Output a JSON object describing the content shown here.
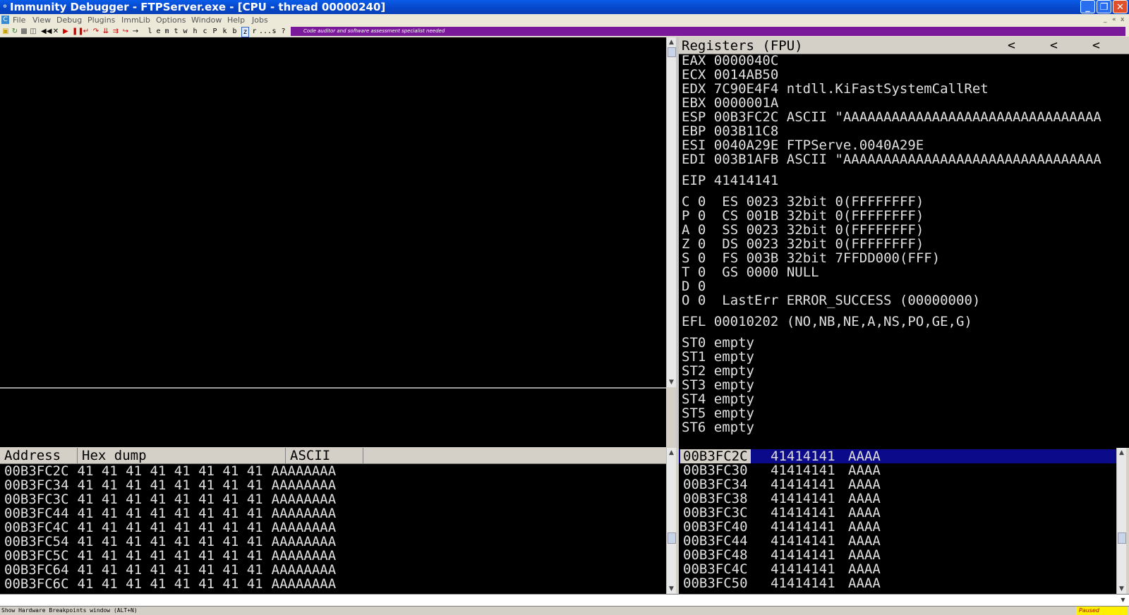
{
  "window": {
    "title": "Immunity Debugger - FTPServer.exe - [CPU - thread 00000240]",
    "min_icon": "minimize-icon",
    "max_icon": "restore-icon",
    "close_icon": "close-icon"
  },
  "menu": {
    "items": [
      "File",
      "View",
      "Debug",
      "Plugins",
      "ImmLib",
      "Options",
      "Window",
      "Help",
      "Jobs"
    ],
    "mdi_controls": [
      "_",
      "«",
      "x"
    ]
  },
  "toolbar": {
    "letters": [
      "l",
      "e",
      "m",
      "t",
      "w",
      "h",
      "c",
      "P",
      "k",
      "b",
      "z",
      "r",
      "...",
      "s",
      "?"
    ],
    "promo": "Code auditor and software assessment specialist needed"
  },
  "registers": {
    "header": "Registers (FPU)",
    "nav": [
      "<",
      "<",
      "<"
    ],
    "gp": [
      {
        "name": "EAX",
        "value": "0000040C",
        "comment": ""
      },
      {
        "name": "ECX",
        "value": "0014AB50",
        "comment": ""
      },
      {
        "name": "EDX",
        "value": "7C90E4F4",
        "comment": "ntdll.KiFastSystemCallRet"
      },
      {
        "name": "EBX",
        "value": "0000001A",
        "comment": ""
      },
      {
        "name": "ESP",
        "value": "00B3FC2C",
        "comment": "ASCII \"AAAAAAAAAAAAAAAAAAAAAAAAAAAAAAAA"
      },
      {
        "name": "EBP",
        "value": "003B11C8",
        "comment": ""
      },
      {
        "name": "ESI",
        "value": "0040A29E",
        "comment": "FTPServe.0040A29E"
      },
      {
        "name": "EDI",
        "value": "003B1AFB",
        "comment": "ASCII \"AAAAAAAAAAAAAAAAAAAAAAAAAAAAAAAA"
      }
    ],
    "eip": {
      "name": "EIP",
      "value": "41414141"
    },
    "flags": [
      {
        "flag": "C",
        "val": "0",
        "seg": "ES",
        "sel": "0023",
        "desc": "32bit 0(FFFFFFFF)"
      },
      {
        "flag": "P",
        "val": "0",
        "seg": "CS",
        "sel": "001B",
        "desc": "32bit 0(FFFFFFFF)"
      },
      {
        "flag": "A",
        "val": "0",
        "seg": "SS",
        "sel": "0023",
        "desc": "32bit 0(FFFFFFFF)"
      },
      {
        "flag": "Z",
        "val": "0",
        "seg": "DS",
        "sel": "0023",
        "desc": "32bit 0(FFFFFFFF)"
      },
      {
        "flag": "S",
        "val": "0",
        "seg": "FS",
        "sel": "003B",
        "desc": "32bit 7FFDD000(FFF)"
      },
      {
        "flag": "T",
        "val": "0",
        "seg": "GS",
        "sel": "0000",
        "desc": "NULL"
      },
      {
        "flag": "D",
        "val": "0",
        "seg": "",
        "sel": "",
        "desc": ""
      },
      {
        "flag": "O",
        "val": "0",
        "seg": "LastErr",
        "sel": "",
        "desc": "ERROR_SUCCESS (00000000)"
      }
    ],
    "efl": {
      "name": "EFL",
      "value": "00010202",
      "desc": "(NO,NB,NE,A,NS,PO,GE,G)"
    },
    "fpu": [
      {
        "name": "ST0",
        "value": "empty"
      },
      {
        "name": "ST1",
        "value": "empty"
      },
      {
        "name": "ST2",
        "value": "empty"
      },
      {
        "name": "ST3",
        "value": "empty"
      },
      {
        "name": "ST4",
        "value": "empty"
      },
      {
        "name": "ST5",
        "value": "empty"
      },
      {
        "name": "ST6",
        "value": "empty"
      }
    ]
  },
  "dump": {
    "headers": [
      "Address",
      "Hex dump",
      "ASCII"
    ],
    "rows": [
      {
        "addr": "00B3FC2C",
        "hex": "41 41 41 41 41 41 41 41",
        "ascii": "AAAAAAAA"
      },
      {
        "addr": "00B3FC34",
        "hex": "41 41 41 41 41 41 41 41",
        "ascii": "AAAAAAAA"
      },
      {
        "addr": "00B3FC3C",
        "hex": "41 41 41 41 41 41 41 41",
        "ascii": "AAAAAAAA"
      },
      {
        "addr": "00B3FC44",
        "hex": "41 41 41 41 41 41 41 41",
        "ascii": "AAAAAAAA"
      },
      {
        "addr": "00B3FC4C",
        "hex": "41 41 41 41 41 41 41 41",
        "ascii": "AAAAAAAA"
      },
      {
        "addr": "00B3FC54",
        "hex": "41 41 41 41 41 41 41 41",
        "ascii": "AAAAAAAA"
      },
      {
        "addr": "00B3FC5C",
        "hex": "41 41 41 41 41 41 41 41",
        "ascii": "AAAAAAAA"
      },
      {
        "addr": "00B3FC64",
        "hex": "41 41 41 41 41 41 41 41",
        "ascii": "AAAAAAAA"
      },
      {
        "addr": "00B3FC6C",
        "hex": "41 41 41 41 41 41 41 41",
        "ascii": "AAAAAAAA"
      }
    ]
  },
  "stack": {
    "rows": [
      {
        "addr": "00B3FC2C",
        "value": "41414141",
        "comment": "AAAA",
        "selected": true
      },
      {
        "addr": "00B3FC30",
        "value": "41414141",
        "comment": "AAAA"
      },
      {
        "addr": "00B3FC34",
        "value": "41414141",
        "comment": "AAAA"
      },
      {
        "addr": "00B3FC38",
        "value": "41414141",
        "comment": "AAAA"
      },
      {
        "addr": "00B3FC3C",
        "value": "41414141",
        "comment": "AAAA"
      },
      {
        "addr": "00B3FC40",
        "value": "41414141",
        "comment": "AAAA"
      },
      {
        "addr": "00B3FC44",
        "value": "41414141",
        "comment": "AAAA"
      },
      {
        "addr": "00B3FC48",
        "value": "41414141",
        "comment": "AAAA"
      },
      {
        "addr": "00B3FC4C",
        "value": "41414141",
        "comment": "AAAA"
      },
      {
        "addr": "00B3FC50",
        "value": "41414141",
        "comment": "AAAA"
      }
    ]
  },
  "status": {
    "hint": "Show Hardware Breakpoints window (ALT+N)",
    "state": "Paused"
  },
  "colors": {
    "titlebar": "#0646c8",
    "pane_bg": "#000000",
    "selection": "#0a0a8a",
    "promo_bg": "#7a1a9a",
    "paused_bg": "#ffef00"
  }
}
